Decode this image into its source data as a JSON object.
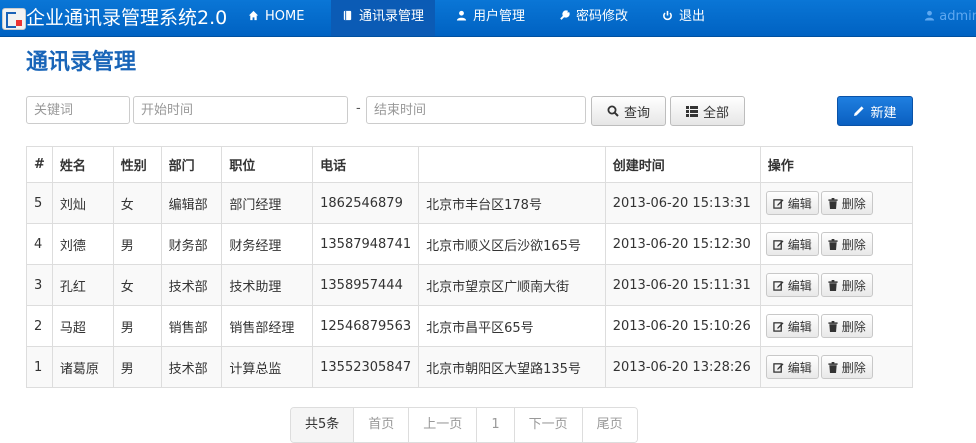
{
  "navbar": {
    "brand": "企业通讯录管理系统2.0",
    "items": [
      {
        "label": "HOME",
        "icon": "home-icon"
      },
      {
        "label": "通讯录管理",
        "icon": "book-icon"
      },
      {
        "label": "用户管理",
        "icon": "user-icon"
      },
      {
        "label": "密码修改",
        "icon": "wrench-icon"
      },
      {
        "label": "退出",
        "icon": "power-icon"
      }
    ],
    "user": "admin",
    "colors": {
      "bar": "#0a6fd0",
      "active": "#0b5bb5"
    }
  },
  "page": {
    "title": "通讯录管理"
  },
  "search": {
    "keyword_placeholder": "关键词",
    "start_placeholder": "开始时间",
    "separator": "-",
    "end_placeholder": "结束时间",
    "query_label": "查询",
    "all_label": "全部",
    "new_label": "新建"
  },
  "table": {
    "headers": [
      "#",
      "姓名",
      "性别",
      "部门",
      "职位",
      "电话",
      "",
      "创建时间",
      "操作"
    ],
    "rows": [
      {
        "id": "5",
        "name": "刘灿",
        "gender": "女",
        "dept": "编辑部",
        "position": "部门经理",
        "phone": "1862546879",
        "address": "北京市丰台区178号",
        "created": "2013-06-20 15:13:31"
      },
      {
        "id": "4",
        "name": "刘德",
        "gender": "男",
        "dept": "财务部",
        "position": "财务经理",
        "phone": "13587948741",
        "address": "北京市顺义区后沙欲165号",
        "created": "2013-06-20 15:12:30"
      },
      {
        "id": "3",
        "name": "孔红",
        "gender": "女",
        "dept": "技术部",
        "position": "技术助理",
        "phone": "1358957444",
        "address": "北京市望京区广顺南大街",
        "created": "2013-06-20 15:11:31"
      },
      {
        "id": "2",
        "name": "马超",
        "gender": "男",
        "dept": "销售部",
        "position": "销售部经理",
        "phone": "12546879563",
        "address": "北京市昌平区65号",
        "created": "2013-06-20 15:10:26"
      },
      {
        "id": "1",
        "name": "诸葛原",
        "gender": "男",
        "dept": "技术部",
        "position": "计算总监",
        "phone": "13552305847",
        "address": "北京市朝阳区大望路135号",
        "created": "2013-06-20 13:28:26"
      }
    ],
    "edit_label": "编辑",
    "delete_label": "删除"
  },
  "pagination": {
    "total": "共5条",
    "first": "首页",
    "prev": "上一页",
    "current": "1",
    "next": "下一页",
    "last": "尾页"
  }
}
